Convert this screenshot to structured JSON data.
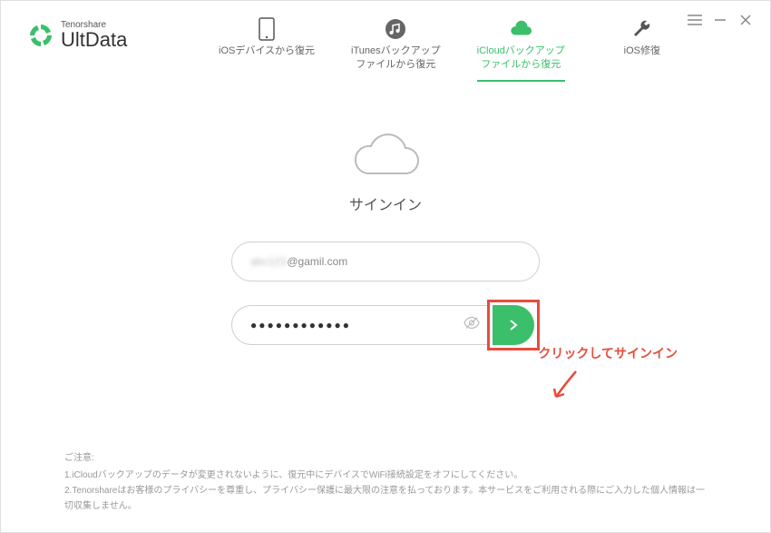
{
  "logo": {
    "brand": "Tenorshare",
    "product": "UltData"
  },
  "tabs": [
    {
      "label": "iOSデバイスから復元"
    },
    {
      "label": "iTunesバックアップ\nファイルから復元"
    },
    {
      "label": "iCloudバックアップ\nファイルから復元"
    },
    {
      "label": "iOS修復"
    }
  ],
  "main": {
    "signin_title": "サインイン",
    "email_blurred": "abc123",
    "email_domain": "@gamil.com",
    "password_dots": "●●●●●●●●●●●●",
    "callout": "クリックしてサインイン"
  },
  "footer": {
    "title": "ご注意:",
    "line1": "1.iCloudバックアップのデータが変更されないように、復元中にデバイスでWiFi接続設定をオフにしてください。",
    "line2": "2.Tenorshareはお客様のプライバシーを尊重し、プライバシー保護に最大限の注意を払っております。本サービスをご利用される際にご入力した個人情報は一切収集しません。"
  }
}
